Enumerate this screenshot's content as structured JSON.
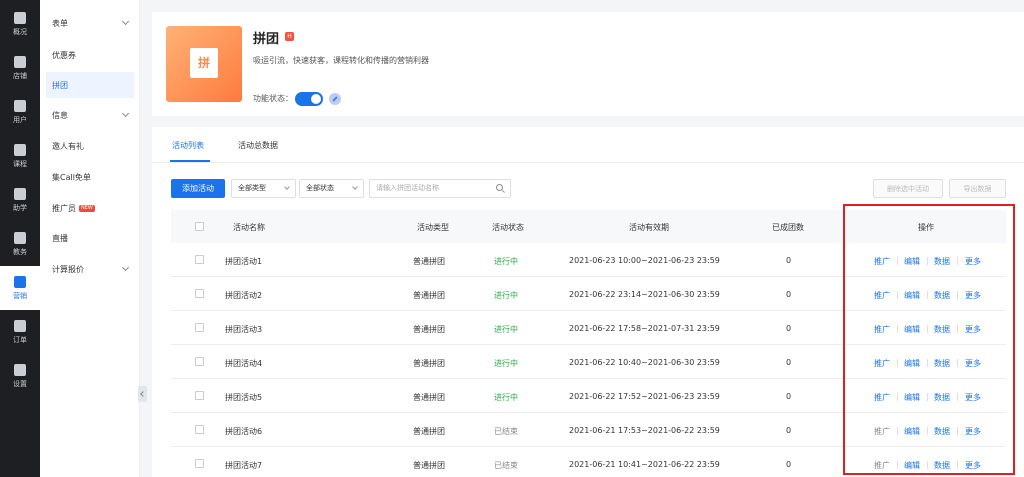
{
  "rail": [
    {
      "label": "概况",
      "icon": "bar-chart-icon"
    },
    {
      "label": "店铺",
      "icon": "store-icon"
    },
    {
      "label": "用户",
      "icon": "users-icon"
    },
    {
      "label": "课程",
      "icon": "book-icon"
    },
    {
      "label": "助学",
      "icon": "monitor-icon"
    },
    {
      "label": "教务",
      "icon": "calendar-icon"
    },
    {
      "label": "营销",
      "icon": "tag-icon",
      "active": true
    },
    {
      "label": "订单",
      "icon": "order-icon"
    },
    {
      "label": "设置",
      "icon": "gear-icon"
    }
  ],
  "subnav": [
    {
      "label": "表单",
      "chevron": true
    },
    {
      "label": "优惠券"
    },
    {
      "label": "拼团",
      "active": true
    },
    {
      "label": "信息",
      "chevron": true
    },
    {
      "label": "邀人有礼"
    },
    {
      "label": "集Call免单"
    },
    {
      "label": "推广员",
      "badge": "NEW"
    },
    {
      "label": "直播"
    },
    {
      "label": "计算报价",
      "chevron": true
    }
  ],
  "header": {
    "icon_glyph": "拼",
    "title": "拼团",
    "title_badge": "H",
    "description": "吸运引流，快速获客，课程转化和传播的营销利器",
    "status_label": "功能状态：",
    "enabled": true
  },
  "tabs": [
    {
      "label": "活动列表",
      "active": true
    },
    {
      "label": "活动总数据"
    }
  ],
  "toolbar": {
    "add_button": "添加活动",
    "type_select": "全部类型",
    "status_select": "全部状态",
    "search_placeholder": "请输入拼团活动名称",
    "delete_button": "删除选中活动",
    "export_button": "导出数据"
  },
  "table": {
    "headers": [
      "活动名称",
      "活动类型",
      "活动状态",
      "活动有效期",
      "已成团数",
      "操作"
    ],
    "rows": [
      {
        "name": "拼团活动1",
        "type": "普通拼团",
        "status": "进行中",
        "period": "2021-06-23 10:00~2021-06-23 23:59",
        "groups": "0"
      },
      {
        "name": "拼团活动2",
        "type": "普通拼团",
        "status": "进行中",
        "period": "2021-06-22 23:14~2021-06-30 23:59",
        "groups": "0"
      },
      {
        "name": "拼团活动3",
        "type": "普通拼团",
        "status": "进行中",
        "period": "2021-06-22 17:58~2021-07-31 23:59",
        "groups": "0"
      },
      {
        "name": "拼团活动4",
        "type": "普通拼团",
        "status": "进行中",
        "period": "2021-06-22 10:40~2021-06-30 23:59",
        "groups": "0"
      },
      {
        "name": "拼团活动5",
        "type": "普通拼团",
        "status": "进行中",
        "period": "2021-06-22 17:52~2021-06-23 23:59",
        "groups": "0"
      },
      {
        "name": "拼团活动6",
        "type": "普通拼团",
        "status": "已结束",
        "period": "2021-06-21 17:53~2021-06-22 23:59",
        "groups": "0"
      },
      {
        "name": "拼团活动7",
        "type": "普通拼团",
        "status": "已结束",
        "period": "2021-06-21 10:41~2021-06-22 23:59",
        "groups": "0"
      }
    ],
    "actions": [
      "推广",
      "编辑",
      "数据",
      "更多"
    ]
  },
  "colors": {
    "primary": "#1a73e8",
    "running": "#2aa84a",
    "ended": "#888888",
    "highlight": "#e02020"
  }
}
